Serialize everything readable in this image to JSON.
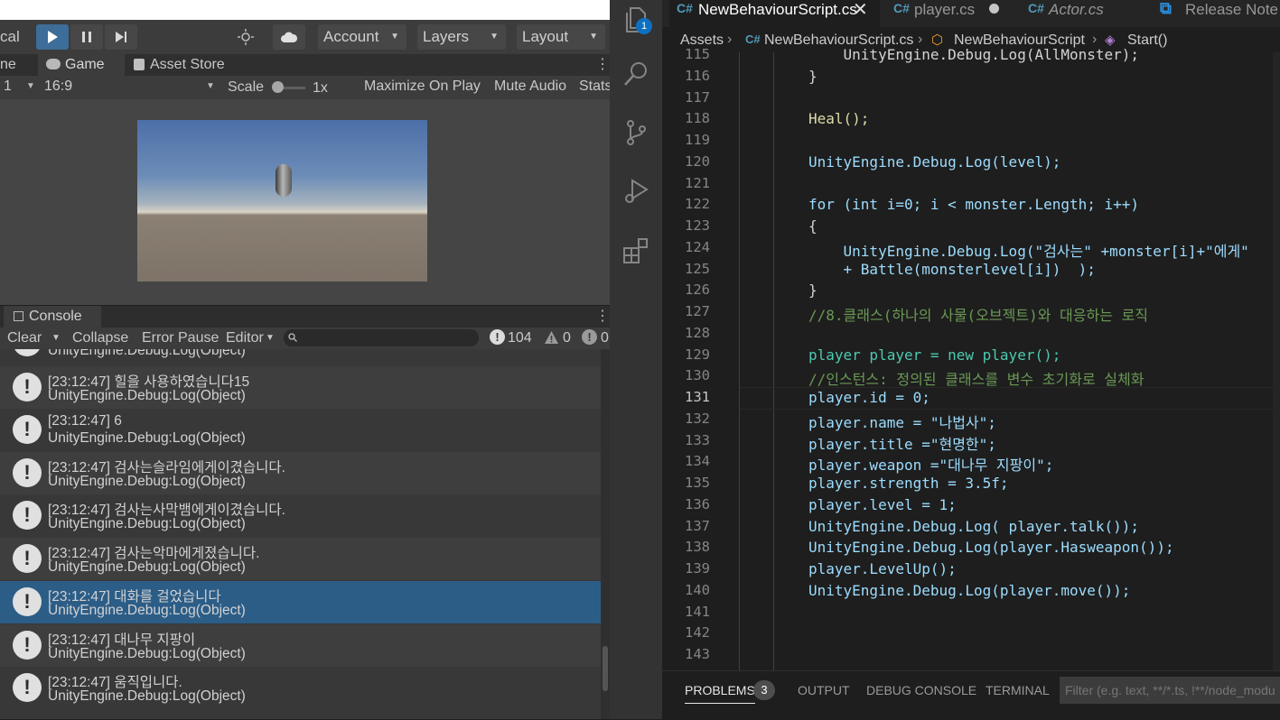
{
  "unity": {
    "toolbar": {
      "left_partial": "cal",
      "account": "Account",
      "layers": "Layers",
      "layout": "Layout"
    },
    "tabs": {
      "partial": "ne",
      "game": "Game",
      "asset_store": "Asset Store"
    },
    "game_options": {
      "display_partial": "1",
      "aspect": "16:9",
      "scale_label": "Scale",
      "scale_value": "1x",
      "maximize": "Maximize On Play",
      "mute": "Mute Audio",
      "stats_partial": "Stats"
    },
    "console": {
      "tab": "Console",
      "clear": "Clear",
      "collapse": "Collapse",
      "error_pause": "Error Pause",
      "editor": "Editor",
      "log_count": "104",
      "warn_count": "0",
      "error_count": "0",
      "rows": [
        {
          "line1": "",
          "line2": "UnityEngine.Debug:Log(Object)"
        },
        {
          "line1": "[23:12:47] 힐을 사용하였습니다15",
          "line2": "UnityEngine.Debug:Log(Object)"
        },
        {
          "line1": "[23:12:47] 6",
          "line2": "UnityEngine.Debug:Log(Object)"
        },
        {
          "line1": "[23:12:47] 검사는슬라임에게이겼습니다.",
          "line2": "UnityEngine.Debug:Log(Object)"
        },
        {
          "line1": "[23:12:47] 검사는사막뱀에게이겼습니다.",
          "line2": "UnityEngine.Debug:Log(Object)"
        },
        {
          "line1": "[23:12:47] 검사는악마에게졌습니다.",
          "line2": "UnityEngine.Debug:Log(Object)"
        },
        {
          "line1": "[23:12:47] 대화를 걸었습니다",
          "line2": "UnityEngine.Debug:Log(Object)"
        },
        {
          "line1": "[23:12:47] 대나무 지팡이",
          "line2": "UnityEngine.Debug:Log(Object)"
        },
        {
          "line1": "[23:12:47] 움직입니다.",
          "line2": "UnityEngine.Debug:Log(Object)"
        }
      ]
    }
  },
  "vscode": {
    "explorer_badge": "1",
    "tabs": [
      {
        "label": "NewBehaviourScript.cs",
        "active": true
      },
      {
        "label": "player.cs",
        "active": false
      },
      {
        "label": "Actor.cs",
        "active": false
      },
      {
        "label": "Release Note",
        "active": false
      }
    ],
    "breadcrumb": [
      "Assets",
      "NewBehaviourScript.cs",
      "NewBehaviourScript",
      "Start()"
    ],
    "line_numbers": [
      "115",
      "116",
      "117",
      "118",
      "119",
      "120",
      "121",
      "122",
      "123",
      "124",
      "125",
      "126",
      "127",
      "128",
      "129",
      "130",
      "131",
      "132",
      "133",
      "134",
      "135",
      "136",
      "137",
      "138",
      "139",
      "140",
      "141",
      "142",
      "143"
    ],
    "code_lines": [
      "    UnityEngine.Debug.Log(AllMonster);",
      "}",
      "",
      "Heal();",
      "",
      "UnityEngine.Debug.Log(level);",
      "",
      "for (int i=0; i < monster.Length; i++)",
      "{",
      "    UnityEngine.Debug.Log(\"검사는\" +monster[i]+\"에게\"",
      "    + Battle(monsterlevel[i])  );",
      "}",
      "//8.클래스(하나의 사물(오브젝트)와 대응하는 로직",
      "",
      "player player = new player();",
      "//인스턴스: 정의된 클래스를 변수 초기화로 실체화",
      "player.id = 0;",
      "player.name = \"나법사\";",
      "player.title =\"현명한\";",
      "player.weapon =\"대나무 지팡이\";",
      "player.strength = 3.5f;",
      "player.level = 1;",
      "UnityEngine.Debug.Log( player.talk());",
      "UnityEngine.Debug.Log(player.Hasweapon());",
      "player.LevelUp();",
      "UnityEngine.Debug.Log(player.move());",
      "",
      "",
      ""
    ],
    "panel": {
      "problems": "PROBLEMS",
      "problems_count": "3",
      "output": "OUTPUT",
      "debug_console": "DEBUG CONSOLE",
      "terminal": "TERMINAL",
      "filter_placeholder": "Filter (e.g. text, **/*.ts, !**/node_modules/**)"
    }
  }
}
